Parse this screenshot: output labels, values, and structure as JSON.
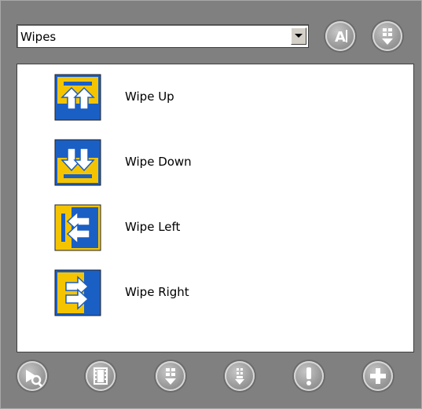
{
  "dropdown": {
    "value": "Wipes"
  },
  "top_buttons": [
    {
      "icon": "text-a-icon"
    },
    {
      "icon": "move-down-icon"
    }
  ],
  "list": {
    "items": [
      {
        "label": "Wipe Up",
        "icon": "wipe-up-icon",
        "primary": "#f5c400",
        "secondary": "#1a5fc4"
      },
      {
        "label": "Wipe Down",
        "icon": "wipe-down-icon",
        "primary": "#1a5fc4",
        "secondary": "#f5c400"
      },
      {
        "label": "Wipe Left",
        "icon": "wipe-left-icon",
        "primary": "#f5c400",
        "secondary": "#1a5fc4"
      },
      {
        "label": "Wipe Right",
        "icon": "wipe-right-icon",
        "primary": "#1a5fc4",
        "secondary": "#f5c400"
      }
    ]
  },
  "bottom_buttons": [
    {
      "icon": "preview-icon"
    },
    {
      "icon": "film-icon"
    },
    {
      "icon": "move-down-icon"
    },
    {
      "icon": "download-icon"
    },
    {
      "icon": "alert-icon"
    },
    {
      "icon": "add-icon"
    }
  ]
}
